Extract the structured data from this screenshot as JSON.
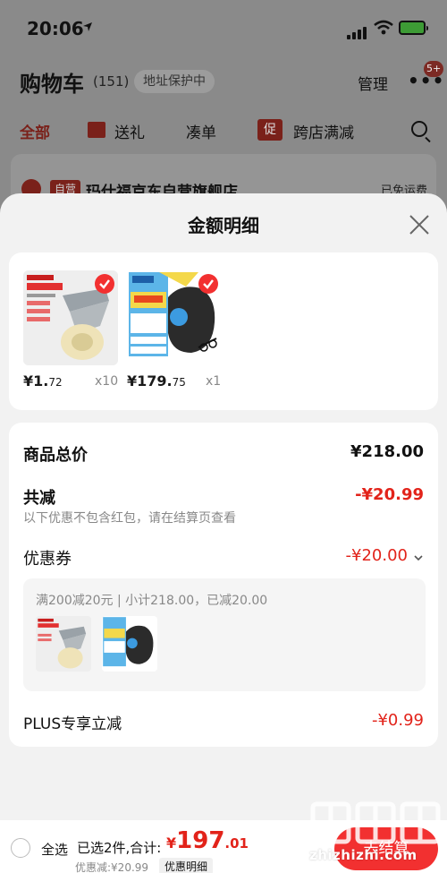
{
  "status_bar": {
    "time": "20:06"
  },
  "cart_header": {
    "title": "购物车",
    "count": "(151)",
    "address_protect": "地址保护中",
    "manage": "管理",
    "message_badge": "5+"
  },
  "tabs": [
    "全部",
    "送礼",
    "凑单",
    "跨店满减"
  ],
  "promo_icon_label": "促",
  "store": {
    "tag": "自营",
    "name": "玛仕福京东自营旗舰店",
    "shipping": "已免运费"
  },
  "sheet": {
    "title": "金额明细",
    "items": [
      {
        "price_main": "¥1.",
        "price_cents": "72",
        "qty": "x10"
      },
      {
        "price_main": "¥179.",
        "price_cents": "75",
        "qty": "x1"
      }
    ],
    "product_total_label": "商品总价",
    "product_total_value": "¥218.00",
    "reduce_label": "共减",
    "reduce_value": "-¥20.99",
    "reduce_note": "以下优惠不包含红包，请在结算页查看",
    "coupon_label": "优惠券",
    "coupon_value": "-¥20.00",
    "coupon_info": "满200减20元 | 小计218.00，已减20.00",
    "plus_label": "PLUS专享立减",
    "plus_value": "-¥0.99"
  },
  "bottom_bar": {
    "select_all": "全选",
    "selected_text": "已选2件,合计:",
    "total_yen": "¥",
    "total_int": "197",
    "total_cents": ".01",
    "discount_text": "优惠减:¥20.99",
    "detail_link": "优惠明细",
    "checkout": "去结算"
  },
  "watermark": {
    "text": "zhizhizhi.com"
  },
  "colors": {
    "accent_red": "#e2231a",
    "checkout_red": "#f23030"
  }
}
